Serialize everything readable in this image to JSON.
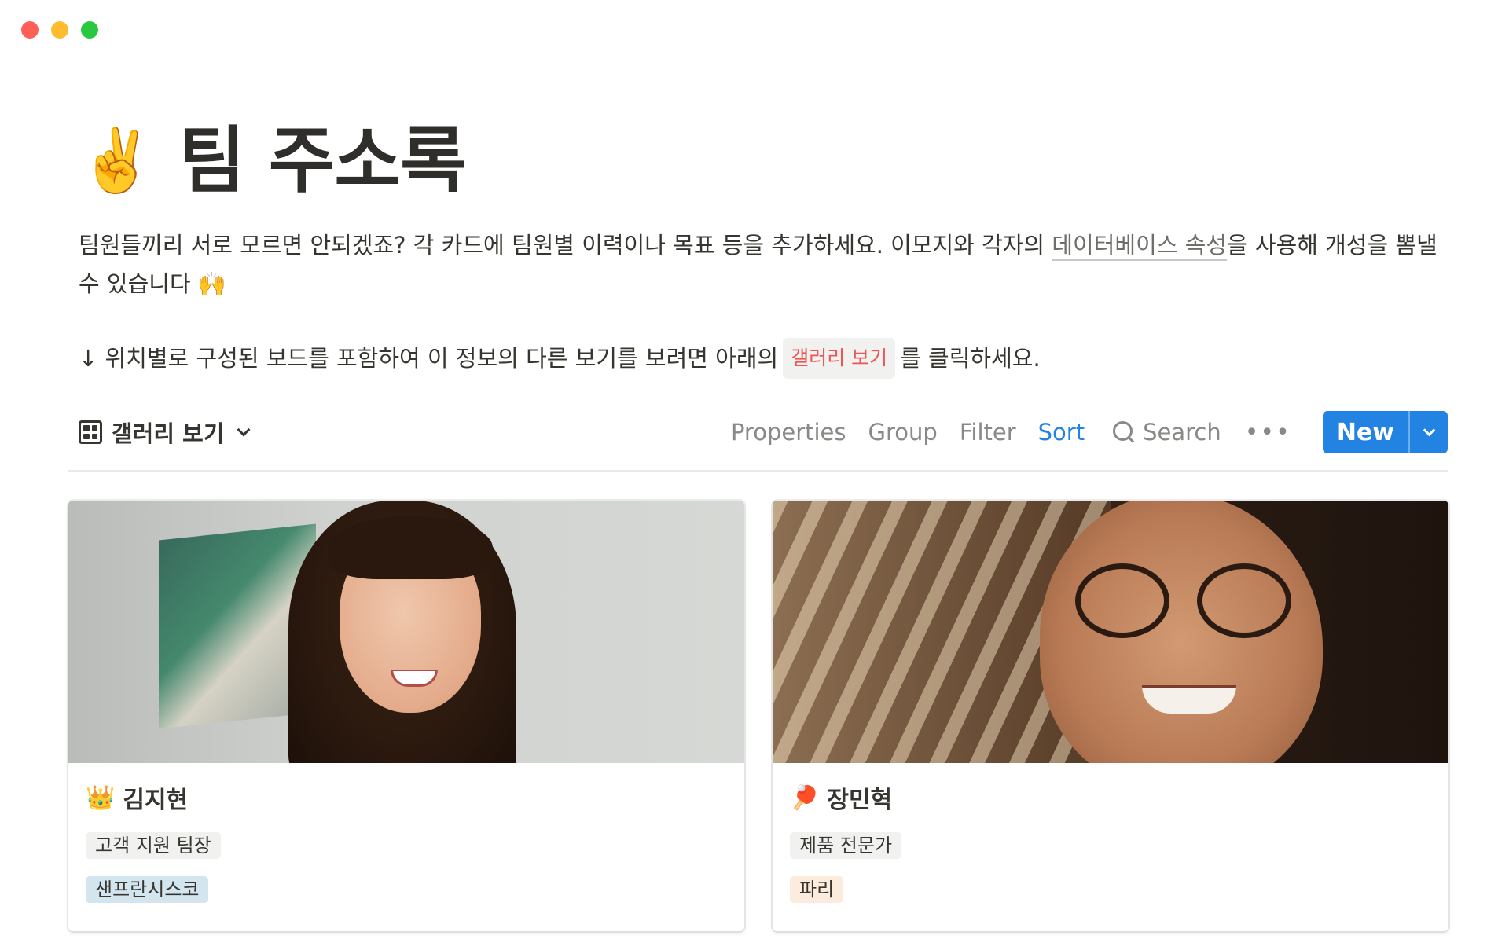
{
  "window": {
    "controls": [
      "close",
      "minimize",
      "zoom"
    ]
  },
  "page": {
    "emoji": "✌️",
    "title": "팀 주소록",
    "description_part1": "팀원들끼리 서로 모르면 안되겠죠? 각 카드에 팀원별 이력이나 목표 등을 추가하세요. 이모지와 각자의 ",
    "description_link": "데이터베이스 속성",
    "description_part2": "을 사용해 개성을 뽐낼 수 있습니다 🙌",
    "hint_part1": "↓ 위치별로 구성된 보드를 포함하여 이 정보의 다른 보기를 보려면 아래의",
    "hint_code": "갤러리 보기",
    "hint_part2": "를 클릭하세요."
  },
  "toolbar": {
    "view_icon": "gallery-grid-icon",
    "view_label": "갤러리 보기",
    "properties": "Properties",
    "group": "Group",
    "filter": "Filter",
    "sort": "Sort",
    "search": "Search",
    "more": "•••",
    "new_label": "New"
  },
  "colors": {
    "accent": "#2383e2",
    "text": "#37352f",
    "muted": "#8a8985",
    "code_red": "#eb5757"
  },
  "cards": [
    {
      "emoji": "👑",
      "name": "김지현",
      "tags": [
        {
          "label": "고객 지원 팀장",
          "color": "gray"
        },
        {
          "label": "샌프란시스코",
          "color": "blue"
        }
      ]
    },
    {
      "emoji": "🏓",
      "name": "장민혁",
      "tags": [
        {
          "label": "제품 전문가",
          "color": "gray"
        },
        {
          "label": "파리",
          "color": "orange"
        }
      ]
    }
  ]
}
